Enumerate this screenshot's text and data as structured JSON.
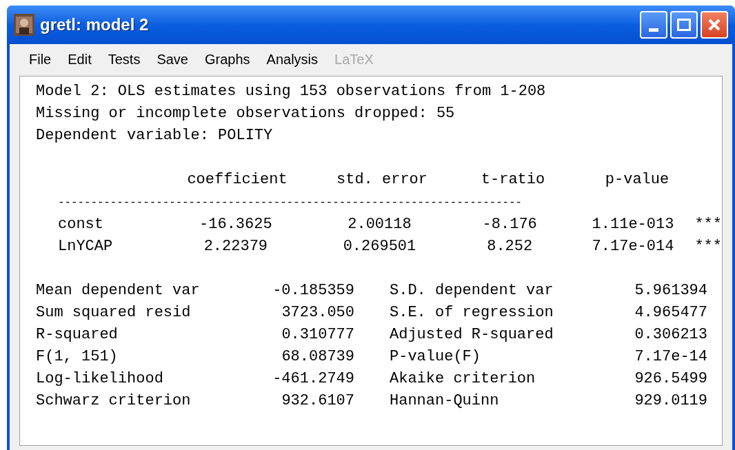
{
  "window": {
    "title": "gretl: model 2"
  },
  "menu": [
    {
      "label": "File",
      "disabled": false
    },
    {
      "label": "Edit",
      "disabled": false
    },
    {
      "label": "Tests",
      "disabled": false
    },
    {
      "label": "Save",
      "disabled": false
    },
    {
      "label": "Graphs",
      "disabled": false
    },
    {
      "label": "Analysis",
      "disabled": false
    },
    {
      "label": "LaTeX",
      "disabled": true
    }
  ],
  "output": {
    "header_lines": [
      "Model 2: OLS estimates using 153 observations from 1-208",
      "Missing or incomplete observations dropped: 55",
      "Dependent variable: POLITY"
    ],
    "coef_columns": [
      "coefficient",
      "std. error",
      "t-ratio",
      "p-value"
    ],
    "rule": "-----------------------------------------------------------------------",
    "coef_rows": [
      {
        "name": "const",
        "values": [
          "-16.3625",
          "2.00118",
          "-8.176",
          "1.11e-013"
        ],
        "stars": "***"
      },
      {
        "name": "LnYCAP",
        "values": [
          "2.22379",
          "0.269501",
          "8.252",
          "7.17e-014"
        ],
        "stars": "***"
      }
    ],
    "stats": [
      {
        "label": "Mean dependent var",
        "value": "-0.185359",
        "label_2": "S.D. dependent var",
        "value_2": "5.961394"
      },
      {
        "label": "Sum squared resid",
        "value": "3723.050",
        "label_2": "S.E. of regression",
        "value_2": "4.965477"
      },
      {
        "label": "R-squared",
        "value": "0.310777",
        "label_2": "Adjusted R-squared",
        "value_2": "0.306213"
      },
      {
        "label": "F(1, 151)",
        "value": "68.08739",
        "label_2": "P-value(F)",
        "value_2": "7.17e-14"
      },
      {
        "label": "Log-likelihood",
        "value": "-461.2749",
        "label_2": "Akaike criterion",
        "value_2": "926.5499"
      },
      {
        "label": "Schwarz criterion",
        "value": "932.6107",
        "label_2": "Hannan-Quinn",
        "value_2": "929.0119"
      }
    ]
  }
}
